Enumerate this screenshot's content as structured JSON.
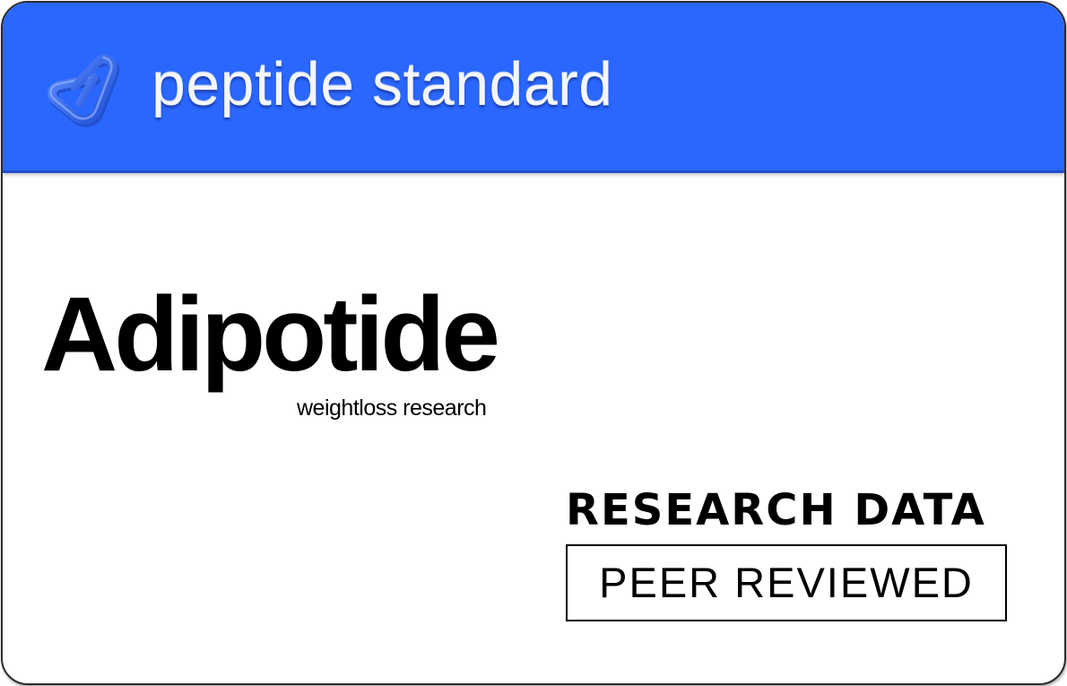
{
  "header": {
    "brand": "peptide standard",
    "logo_icon": "triangular-knot-icon",
    "background_color": "#2a67ff"
  },
  "product": {
    "name": "Adipotide",
    "subtitle": "weightloss research"
  },
  "badge": {
    "heading": "RESEARCH DATA",
    "boxed_label": "PEER REVIEWED"
  }
}
